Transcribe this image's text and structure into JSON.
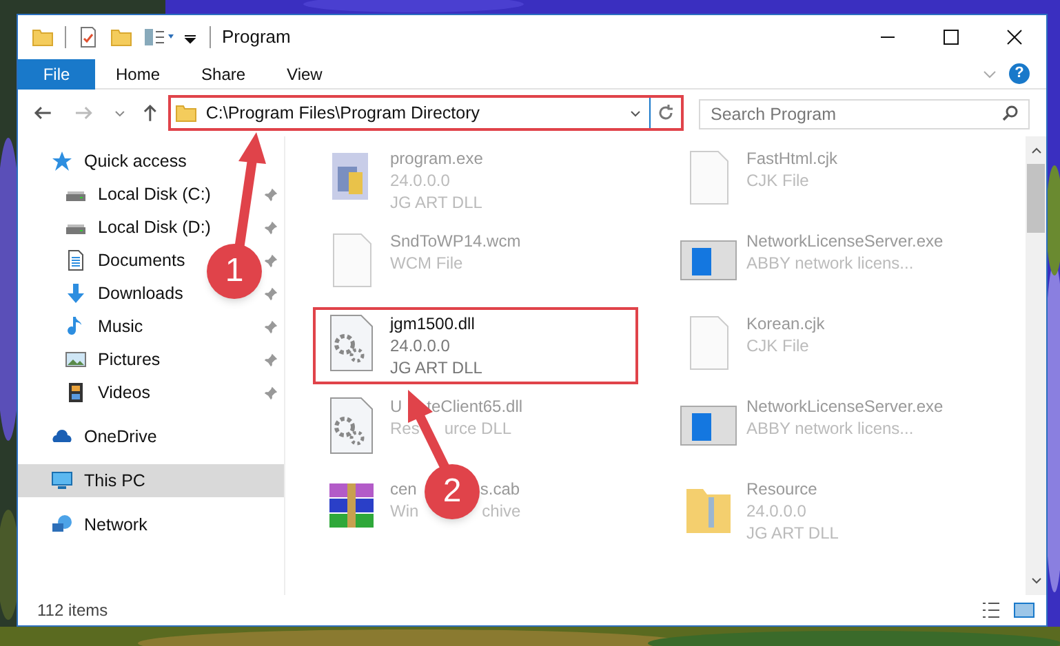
{
  "window": {
    "title": "Program"
  },
  "ribbon": {
    "tabs": [
      {
        "label": "File",
        "selected": true
      },
      {
        "label": "Home",
        "selected": false
      },
      {
        "label": "Share",
        "selected": false
      },
      {
        "label": "View",
        "selected": false
      }
    ],
    "help": "?"
  },
  "address": {
    "path": "C:\\Program Files\\Program Directory",
    "highlighted": true
  },
  "search": {
    "placeholder": "Search Program"
  },
  "sidebar": {
    "items": [
      {
        "label": "Quick access",
        "kind": "star",
        "selected": false,
        "children": [
          {
            "label": "Local Disk (C:)",
            "kind": "disk",
            "pinned": true,
            "selected": false
          },
          {
            "label": "Local Disk (D:)",
            "kind": "disk",
            "pinned": true,
            "selected": false
          },
          {
            "label": "Documents",
            "kind": "doc",
            "pinned": true,
            "selected": false
          },
          {
            "label": "Downloads",
            "kind": "download",
            "pinned": true,
            "selected": false
          },
          {
            "label": "Music",
            "kind": "music",
            "pinned": true,
            "selected": false
          },
          {
            "label": "Pictures",
            "kind": "pictures",
            "pinned": true,
            "selected": false
          },
          {
            "label": "Videos",
            "kind": "videos",
            "pinned": true,
            "selected": false
          }
        ]
      },
      {
        "label": "OneDrive",
        "kind": "cloud",
        "selected": false
      },
      {
        "label": "This PC",
        "kind": "pc",
        "selected": true
      },
      {
        "label": "Network",
        "kind": "network",
        "selected": false
      }
    ]
  },
  "files": [
    {
      "name": [
        "program.exe"
      ],
      "details": [
        [
          "24.0.0.0"
        ],
        [
          "JG ART DLL"
        ]
      ],
      "kind": "app",
      "highlighted": false
    },
    {
      "name": [
        "FastHtml.cjk"
      ],
      "details": [
        [
          "CJK File"
        ]
      ],
      "kind": "blank",
      "highlighted": false
    },
    {
      "name": [
        "SndToWP14.wcm"
      ],
      "details": [
        [
          "WCM File"
        ]
      ],
      "kind": "blank",
      "highlighted": false
    },
    {
      "name": [
        "NetworkLicenseServer.exe"
      ],
      "details": [
        [
          "ABBY network licens..."
        ]
      ],
      "kind": "window",
      "highlighted": false
    },
    {
      "name": [
        "jgm1500.dll"
      ],
      "details": [
        [
          "24.0.0.0"
        ],
        [
          "JG ART DLL"
        ]
      ],
      "kind": "dll",
      "highlighted": true
    },
    {
      "name": [
        "Korean.cjk"
      ],
      "details": [
        [
          "CJK File"
        ]
      ],
      "kind": "blank",
      "highlighted": false
    },
    {
      "name": [
        "U",
        "teClient65.dll"
      ],
      "details": [
        [
          "Res",
          "urce DLL"
        ]
      ],
      "kind": "dll",
      "highlighted": false
    },
    {
      "name": [
        "NetworkLicenseServer.exe"
      ],
      "details": [
        [
          "ABBY network licens..."
        ]
      ],
      "kind": "window",
      "highlighted": false
    },
    {
      "name": [
        "cen",
        "s.cab"
      ],
      "details": [
        [
          "Win",
          "chive"
        ]
      ],
      "kind": "archive",
      "highlighted": false
    },
    {
      "name": [
        "Resource"
      ],
      "details": [
        [
          "24.0.0.0"
        ],
        [
          "JG ART DLL"
        ]
      ],
      "kind": "folder",
      "highlighted": false
    }
  ],
  "status_bar": {
    "count": "112 items"
  },
  "callouts": [
    {
      "number": "1"
    },
    {
      "number": "2"
    }
  ]
}
